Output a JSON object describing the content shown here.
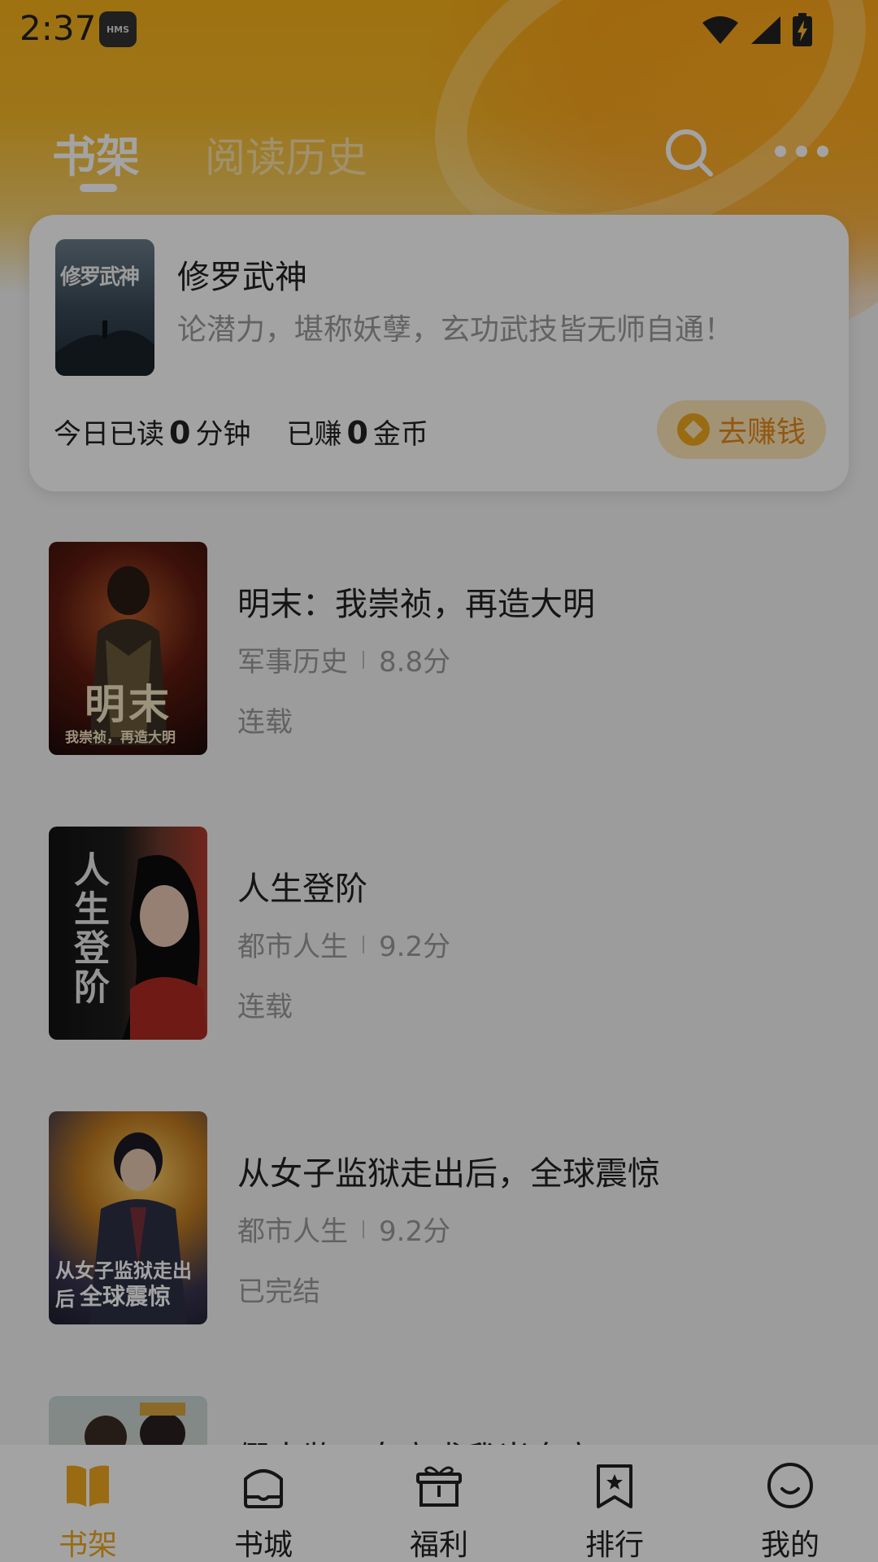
{
  "status_bar": {
    "time": "2:37",
    "badge": "HMS"
  },
  "header": {
    "tabs": [
      {
        "label": "书架",
        "active": true
      },
      {
        "label": "阅读历史",
        "active": false
      }
    ],
    "search_icon": "search-icon",
    "more_icon": "more-icon"
  },
  "summary_card": {
    "book_title": "修罗武神",
    "cover_text": "修罗武神",
    "description": "论潜力，堪称妖孽，玄功武技皆无师自通！",
    "read_prefix": "今日已读",
    "read_minutes": "0",
    "read_unit": "分钟",
    "earned_prefix": "已赚",
    "earned_coins": "0",
    "earned_unit": "金币",
    "earn_button": "去赚钱"
  },
  "books": [
    {
      "title": "明末：我崇祯，再造大明",
      "category": "军事历史",
      "score": "8.8分",
      "status": "连载",
      "cover_big": "明末",
      "cover_small": "我崇祯，再造大明"
    },
    {
      "title": "人生登阶",
      "category": "都市人生",
      "score": "9.2分",
      "status": "连载",
      "cover_big": "人生登阶"
    },
    {
      "title": "从女子监狱走出后，全球震惊",
      "category": "都市人生",
      "score": "9.2分",
      "status": "已完结",
      "cover_l1": "从女子监狱走出后",
      "cover_l2": "全球震惊"
    },
    {
      "title": "假太监：女帝求我当皇帝"
    }
  ],
  "bottom_nav": [
    {
      "label": "书架",
      "icon": "book-icon",
      "active": true
    },
    {
      "label": "书城",
      "icon": "bookstore-icon",
      "active": false
    },
    {
      "label": "福利",
      "icon": "gift-icon",
      "active": false
    },
    {
      "label": "排行",
      "icon": "ranking-icon",
      "active": false
    },
    {
      "label": "我的",
      "icon": "profile-icon",
      "active": false
    }
  ],
  "colors": {
    "accent": "#f0a81e",
    "header_bg": "#f7b21a",
    "earn_text": "#e4881a"
  }
}
